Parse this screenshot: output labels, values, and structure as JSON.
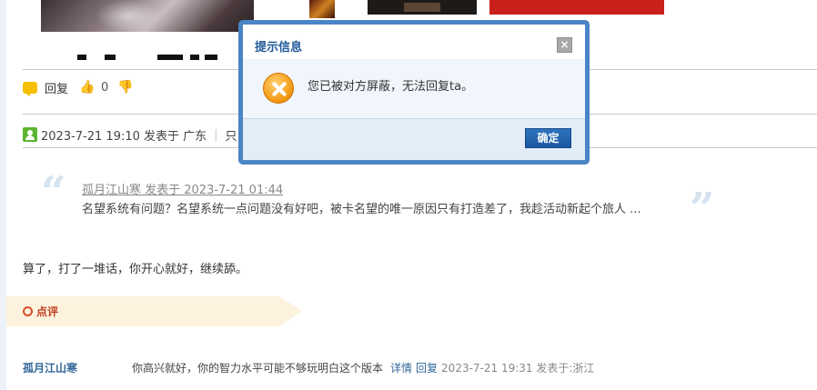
{
  "post": {
    "reply_label": "回复",
    "vote_count": "0"
  },
  "post_meta": {
    "time": "2023-7-21 19:10 发表于 广东",
    "separator": "|",
    "extra": "只"
  },
  "quote": {
    "author": "孤月江山寒 发表于 2023-7-21 01:44",
    "text": "名望系统有问题？名望系统一点问题没有好吧，被卡名望的唯一原因只有打造差了，我趁活动新起个旅人 ..."
  },
  "reply_body": "算了，打了一堆话，你开心就好，继续舔。",
  "comment_section": {
    "label": "点评"
  },
  "comment": {
    "user": "孤月江山寒",
    "text": "你高兴就好，你的智力水平可能不够玩明白这个版本",
    "detail": "详情",
    "reply": "回复",
    "time": "2023-7-21 19:31 发表于:浙江"
  },
  "dialog": {
    "title": "提示信息",
    "close": "×",
    "message": "您已被对方屏蔽，无法回复ta。",
    "ok_label": "确定"
  }
}
